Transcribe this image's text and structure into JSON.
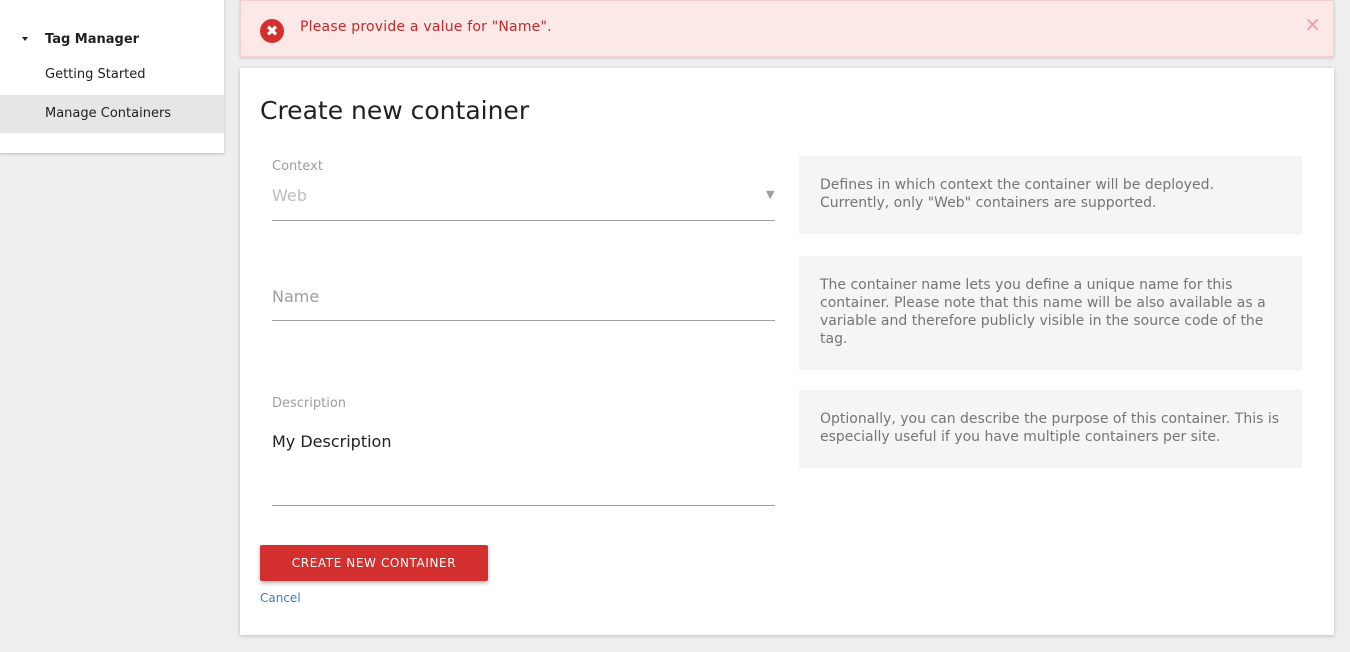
{
  "sidebar": {
    "section_title": "Tag Manager",
    "items": [
      {
        "label": "Getting Started",
        "active": false
      },
      {
        "label": "Manage Containers",
        "active": true
      }
    ]
  },
  "notification": {
    "type": "error",
    "message": "Please provide a value for \"Name\".",
    "icon": "error-icon",
    "close_symbol": "×"
  },
  "form": {
    "title": "Create new container",
    "context": {
      "label": "Context",
      "value": "Web",
      "help": "Defines in which context the container will be deployed. Currently, only \"Web\" containers are supported."
    },
    "name": {
      "placeholder": "Name",
      "value": "",
      "help": "The container name lets you define a unique name for this container. Please note that this name will be also available as a variable and therefore publicly visible in the source code of the tag."
    },
    "description": {
      "label": "Description",
      "value": "My Description",
      "help": "Optionally, you can describe the purpose of this container. This is especially useful if you have multiple containers per site."
    },
    "submit_label": "CREATE NEW CONTAINER",
    "cancel_label": "Cancel"
  },
  "colors": {
    "accent": "#d32f2f",
    "link": "#3b7cc4",
    "error_bg": "#fde8e8"
  }
}
